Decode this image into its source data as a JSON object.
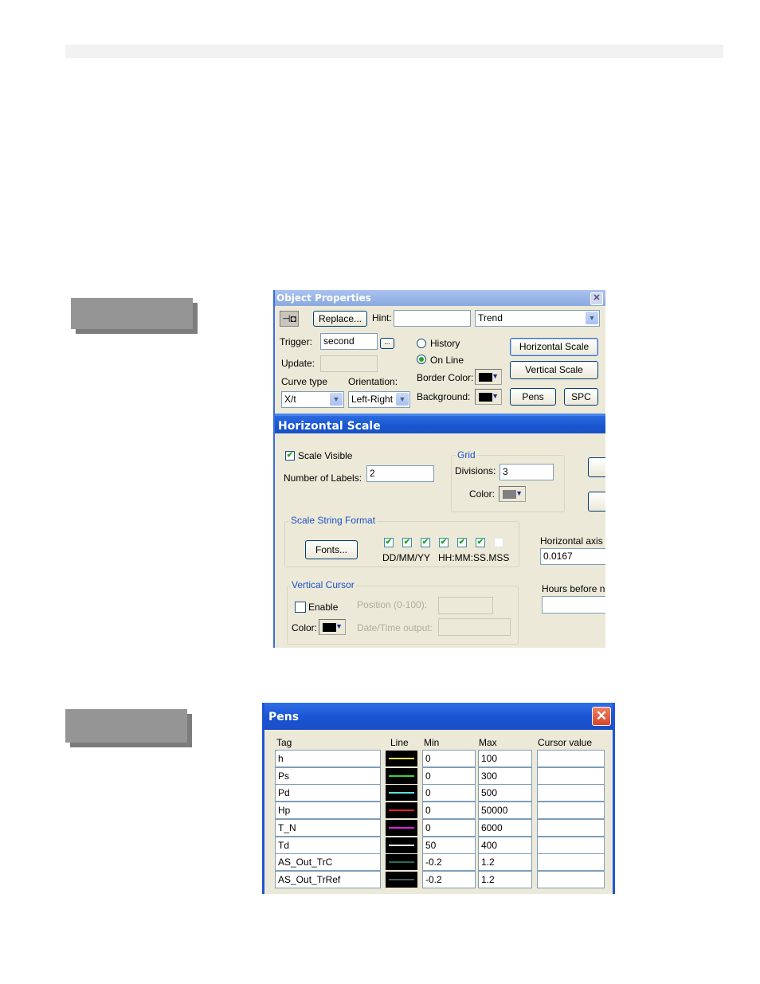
{
  "object_properties": {
    "title": "Object Properties",
    "pin_icon": "pushpin-icon",
    "replace_label": "Replace...",
    "hint_label": "Hint:",
    "hint_value": "",
    "type_value": "Trend",
    "trigger_label": "Trigger:",
    "trigger_value": "second",
    "trigger_browse": "...",
    "update_label": "Update:",
    "update_value": "",
    "curve_type_label": "Curve type",
    "curve_type_value": "X/t",
    "orientation_label": "Orientation:",
    "orientation_value": "Left-Right",
    "mode_options": [
      {
        "label": "History",
        "selected": false
      },
      {
        "label": "On Line",
        "selected": true
      }
    ],
    "border_color_label": "Border Color:",
    "border_color": "#000000",
    "background_label": "Background:",
    "background_color": "#000000",
    "buttons": {
      "horizontal_scale": "Horizontal Scale",
      "vertical_scale": "Vertical Scale",
      "pens": "Pens",
      "spc": "SPC"
    }
  },
  "horizontal_scale": {
    "title": "Horizontal Scale",
    "scale_visible_label": "Scale Visible",
    "scale_visible": true,
    "number_of_labels_label": "Number of Labels:",
    "number_of_labels": "2",
    "grid": {
      "title": "Grid",
      "divisions_label": "Divisions:",
      "divisions": "3",
      "color_label": "Color:",
      "color": "#808080"
    },
    "scale_string_format": {
      "title": "Scale String Format",
      "fonts_label": "Fonts...",
      "format_checks": [
        true,
        true,
        true,
        true,
        true,
        true,
        false
      ],
      "date_format": "DD/MM/YY",
      "time_format": "HH:MM:SS.MSS"
    },
    "horizontal_axis_label": "Horizontal axis D",
    "horizontal_axis_value": "0.0167",
    "hours_before_label": "Hours before no",
    "hours_before_value": "",
    "vertical_cursor": {
      "title": "Vertical Cursor",
      "enable_label": "Enable",
      "enabled": false,
      "position_label": "Position (0-100):",
      "position_value": "",
      "color_label": "Color:",
      "color": "#000000",
      "datetime_label": "Date/Time output:",
      "datetime_value": ""
    }
  },
  "pens": {
    "title": "Pens",
    "columns": [
      "Tag",
      "Line",
      "Min",
      "Max",
      "Cursor value"
    ],
    "rows": [
      {
        "tag": "h",
        "color": "#f0e060",
        "min": "0",
        "max": "100",
        "cursor": ""
      },
      {
        "tag": "Ps",
        "color": "#40d040",
        "min": "0",
        "max": "300",
        "cursor": ""
      },
      {
        "tag": "Pd",
        "color": "#60e0e0",
        "min": "0",
        "max": "500",
        "cursor": ""
      },
      {
        "tag": "Hp",
        "color": "#ff2020",
        "min": "0",
        "max": "50000",
        "cursor": ""
      },
      {
        "tag": "T_N",
        "color": "#e020e0",
        "min": "0",
        "max": "6000",
        "cursor": ""
      },
      {
        "tag": "Td",
        "color": "#ffffff",
        "min": "50",
        "max": "400",
        "cursor": ""
      },
      {
        "tag": "AS_Out_TrC",
        "color": "#2a6a5a",
        "min": "-0.2",
        "max": "1.2",
        "cursor": ""
      },
      {
        "tag": "AS_Out_TrRef",
        "color": "#4a5a5a",
        "min": "-0.2",
        "max": "1.2",
        "cursor": ""
      }
    ]
  }
}
